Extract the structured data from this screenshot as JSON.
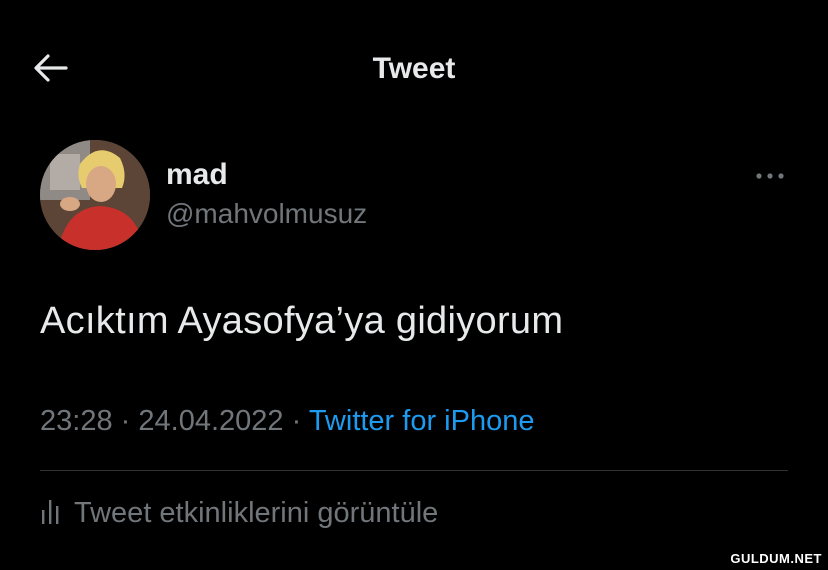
{
  "header": {
    "title": "Tweet",
    "back_icon": "arrow-left-icon"
  },
  "author": {
    "display_name": "mad",
    "handle": "@mahvolmusuz",
    "avatar_icon": "avatar-photo"
  },
  "tweet": {
    "text": "Acıktım Ayasofya’ya gidiyorum",
    "time": "23:28",
    "separator": "·",
    "date": "24.04.2022",
    "source": "Twitter for iPhone"
  },
  "more_icon": "more-dots-icon",
  "activity": {
    "icon": "analytics-icon",
    "label": "Tweet etkinliklerini görüntüle"
  },
  "watermark": "GULDUM.NET",
  "colors": {
    "background": "#000000",
    "text": "#e7e9ea",
    "muted": "#71767b",
    "link": "#1d9bf0",
    "divider": "#2f3336"
  }
}
